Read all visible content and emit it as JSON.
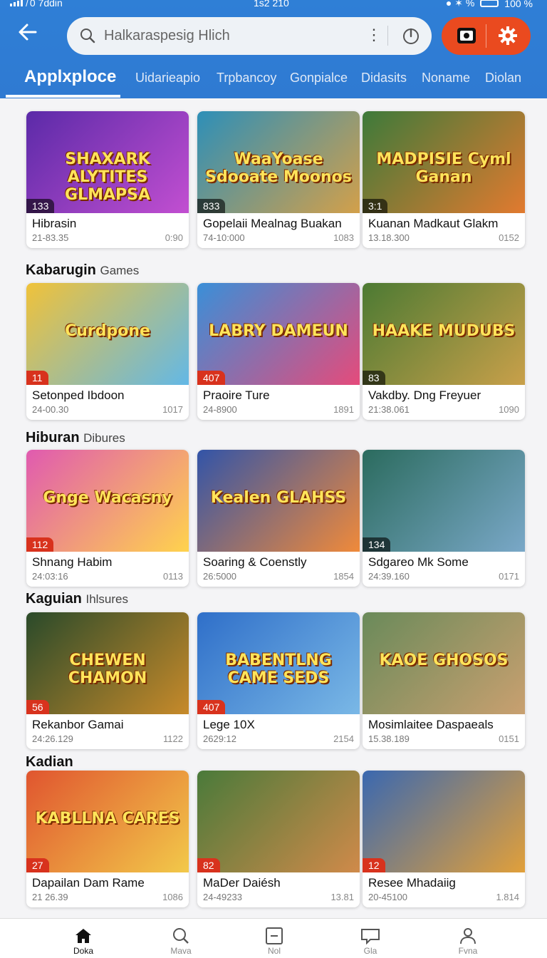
{
  "status": {
    "left": "̸ 0 7ddin",
    "time": "1s2 210",
    "right": "● ✶ % ",
    "battery": "100 %"
  },
  "header": {
    "search_placeholder": "Halkaraspesig Hlich",
    "dots": "⋮"
  },
  "tabs": [
    {
      "label": "Applxploce",
      "active": true
    },
    {
      "label": "Uidarieapio"
    },
    {
      "label": "Trpbancoy"
    },
    {
      "label": "Gonpialce"
    },
    {
      "label": "Didasits"
    },
    {
      "label": "Noname"
    },
    {
      "label": "Diolan"
    }
  ],
  "sections": [
    {
      "title": "Kabarugin",
      "subtitle": "Games"
    },
    {
      "title": "Hiburan",
      "subtitle": "Dibures"
    },
    {
      "title": "Kaguian",
      "subtitle": "Ihlsures"
    },
    {
      "title": "Kadian",
      "subtitle": ""
    }
  ],
  "cards": [
    {
      "thumb_title": "SHAXARK ALYTITES GLMAPSA",
      "badge": "133",
      "name": "Hibrasin",
      "date": "21-83.35",
      "count": "0:90"
    },
    {
      "thumb_title": "WaaYoase Sdooate Moonos",
      "badge": "833",
      "name": "Gopelaii Mealnag Buakan",
      "date": "74-10:000",
      "count": "1083"
    },
    {
      "thumb_title": "MADPISIE Cyml Ganan",
      "badge": "3:1",
      "name": "Kuanan Madkaut Glakm",
      "date": "13.18.300",
      "count": "0152"
    },
    {
      "thumb_title": "Curdpone",
      "badge": "11",
      "name": "Setonped Ibdoon",
      "date": "24-00.30",
      "count": "1017"
    },
    {
      "thumb_title": "LABRY DAMEUN",
      "badge": "407",
      "name": "Praoire Ture",
      "date": "24-8900",
      "count": "1891"
    },
    {
      "thumb_title": "HAAKE MUDUBS",
      "badge": "83",
      "name": "Vakdby. Dng Freyuer",
      "date": "21:38.061",
      "count": "1090"
    },
    {
      "thumb_title": "Gnge Wacasny",
      "badge": "112",
      "name": "Shnang Habim",
      "date": "24:03:16",
      "count": "0113"
    },
    {
      "thumb_title": "Kealen GLAHSS",
      "badge": "",
      "name": "Soaring & Coenstly",
      "date": "26:5000",
      "count": "1854"
    },
    {
      "thumb_title": "",
      "badge": "134",
      "name": "Sdgareo Mk Some",
      "date": "24:39.160",
      "count": "0171"
    },
    {
      "thumb_title": "CHEWEN CHAMON",
      "badge": "56",
      "name": "Rekanbor Gamai",
      "date": "24:26.129",
      "count": "1122"
    },
    {
      "thumb_title": "BABENTLNG CAME SEDS",
      "badge": "407",
      "name": "Lege 10X",
      "date": "2629:12",
      "count": "2154"
    },
    {
      "thumb_title": "KAOE GHOSOS",
      "badge": "",
      "name": "Mosimlaitee Daspaeals",
      "date": "15.38.189",
      "count": "0151"
    },
    {
      "thumb_title": "KABLLNA CARES",
      "badge": "27",
      "name": "Dapailan Dam Rame",
      "date": "21 26.39",
      "count": "1086"
    },
    {
      "thumb_title": "",
      "badge": "82",
      "name": "MaDer Daiésh",
      "date": "24-49233",
      "count": "13.81"
    },
    {
      "thumb_title": "",
      "badge": "12",
      "name": "Resee Mhadaiig",
      "date": "20-45100",
      "count": "1.814"
    }
  ],
  "bottom_nav": [
    {
      "label": "Doka",
      "icon": "home-icon",
      "active": true
    },
    {
      "label": "Mava",
      "icon": "search-icon"
    },
    {
      "label": "Nol",
      "icon": "minus-square-icon"
    },
    {
      "label": "Gla",
      "icon": "chat-icon"
    },
    {
      "label": "Fvna",
      "icon": "profile-icon"
    }
  ],
  "colors": {
    "header": "#2f7fd6",
    "accent": "#ea4a1f",
    "badge": "#d8321d"
  }
}
